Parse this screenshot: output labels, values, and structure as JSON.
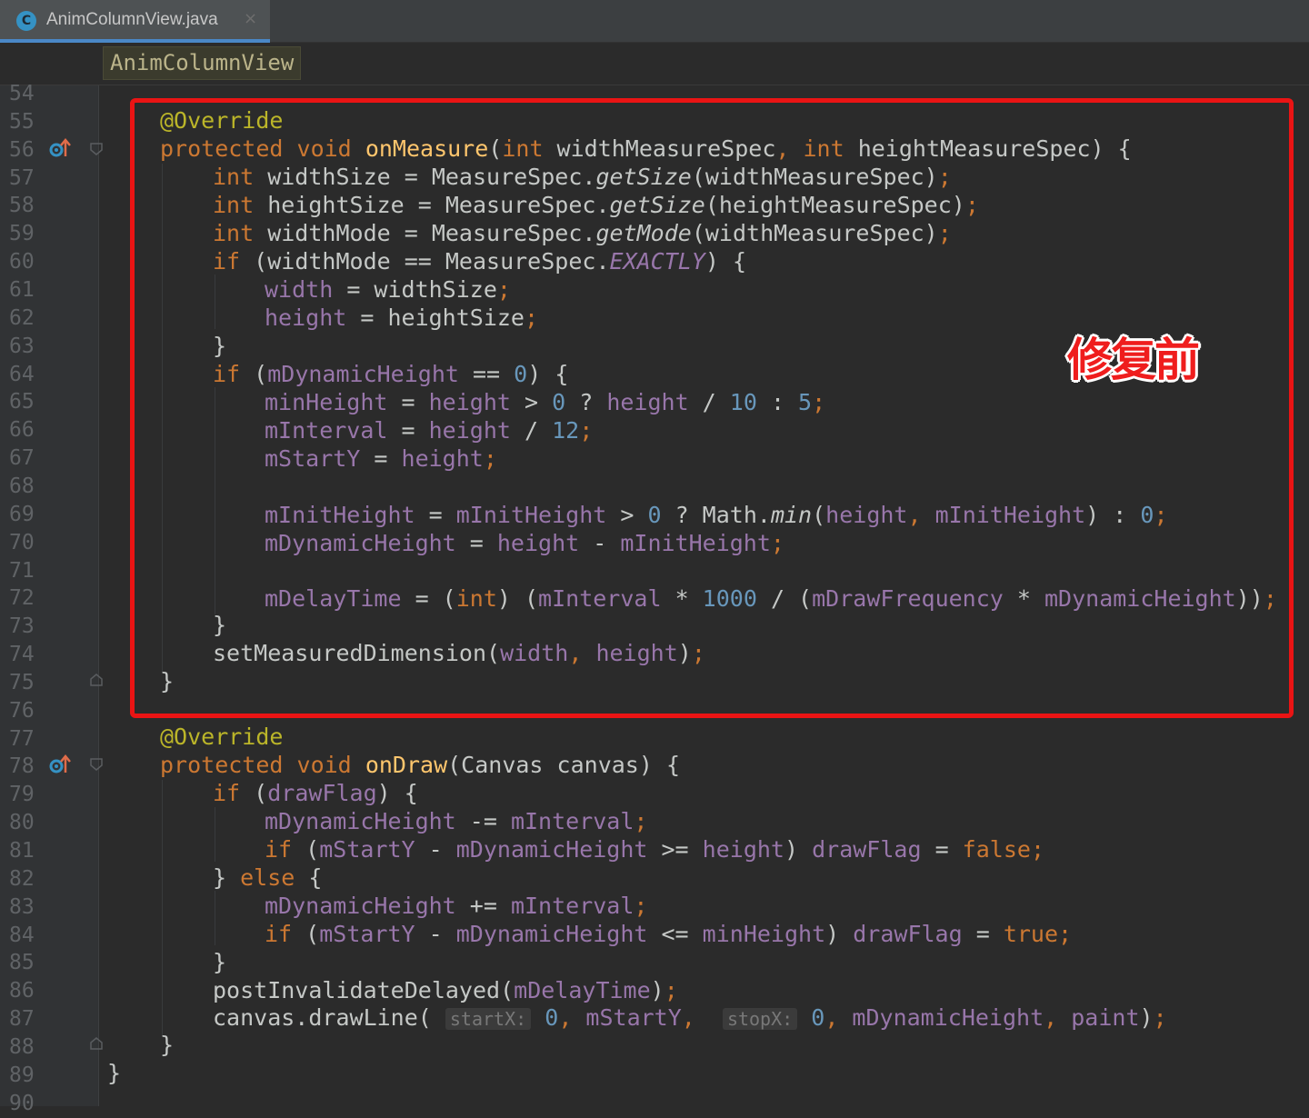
{
  "tab": {
    "icon_letter": "C",
    "filename": "AnimColumnView.java",
    "close_symbol": "×"
  },
  "breadcrumb": {
    "class_name": "AnimColumnView"
  },
  "line_numbers": [
    "54",
    "55",
    "56",
    "57",
    "58",
    "59",
    "60",
    "61",
    "62",
    "63",
    "64",
    "65",
    "66",
    "67",
    "68",
    "69",
    "70",
    "71",
    "72",
    "73",
    "74",
    "75",
    "76",
    "77",
    "78",
    "79",
    "80",
    "81",
    "82",
    "83",
    "84",
    "85",
    "86",
    "87",
    "88",
    "89",
    "90"
  ],
  "annotation": {
    "label": "修复前",
    "color": "#ea1414"
  },
  "colors": {
    "keyword": "#cc7832",
    "annotation": "#bbb529",
    "method": "#ffc66d",
    "field": "#9876aa",
    "number": "#6897bb",
    "text": "#c5c8c6"
  },
  "gutter_icons": [
    "override-method-icon",
    "override-method-icon"
  ],
  "code": {
    "l55": {
      "annotation": "@Override"
    },
    "l56": {
      "t1": "protected",
      "t2": "void",
      "t3": "onMeasure",
      "t4": "(",
      "t5": "int",
      "t6": " widthMeasureSpec",
      "t7": ", ",
      "t8": "int",
      "t9": " heightMeasureSpec) {"
    },
    "l57": {
      "t1": "int",
      "t2": " widthSize = MeasureSpec.",
      "t3": "getSize",
      "t4": "(widthMeasureSpec)",
      "t5": ";"
    },
    "l58": {
      "t1": "int",
      "t2": " heightSize = MeasureSpec.",
      "t3": "getSize",
      "t4": "(heightMeasureSpec)",
      "t5": ";"
    },
    "l59": {
      "t1": "int",
      "t2": " widthMode = MeasureSpec.",
      "t3": "getMode",
      "t4": "(widthMeasureSpec)",
      "t5": ";"
    },
    "l60": {
      "t1": "if",
      "t2": " (widthMode == MeasureSpec.",
      "t3": "EXACTLY",
      "t4": ") {"
    },
    "l61": {
      "t1": "width",
      "t2": " = widthSize",
      "t3": ";"
    },
    "l62": {
      "t1": "height",
      "t2": " = heightSize",
      "t3": ";"
    },
    "l63": {
      "t1": "}"
    },
    "l64": {
      "t1": "if",
      "t2": " (",
      "t3": "mDynamicHeight",
      "t4": " == ",
      "t5": "0",
      "t6": ") {"
    },
    "l65": {
      "t1": "minHeight",
      "t2": " = ",
      "t3": "height",
      "t4": " > ",
      "t5": "0",
      "t6": " ? ",
      "t7": "height",
      "t8": " / ",
      "t9": "10",
      "t10": " : ",
      "t11": "5",
      "t12": ";"
    },
    "l66": {
      "t1": "mInterval",
      "t2": " = ",
      "t3": "height",
      "t4": " / ",
      "t5": "12",
      "t6": ";"
    },
    "l67": {
      "t1": "mStartY",
      "t2": " = ",
      "t3": "height",
      "t4": ";"
    },
    "l69": {
      "t1": "mInitHeight",
      "t2": " = ",
      "t3": "mInitHeight",
      "t4": " > ",
      "t5": "0",
      "t6": " ? Math.",
      "t7": "min",
      "t8": "(",
      "t9": "height",
      "t10": ", ",
      "t11": "mInitHeight",
      "t12": ") : ",
      "t13": "0",
      "t14": ";"
    },
    "l70": {
      "t1": "mDynamicHeight",
      "t2": " = ",
      "t3": "height",
      "t4": " - ",
      "t5": "mInitHeight",
      "t6": ";"
    },
    "l72": {
      "t1": "mDelayTime",
      "t2": " = (",
      "t3": "int",
      "t4": ") (",
      "t5": "mInterval",
      "t6": " * ",
      "t7": "1000",
      "t8": " / (",
      "t9": "mDrawFrequency",
      "t10": " * ",
      "t11": "mDynamicHeight",
      "t12": "))",
      "t13": ";"
    },
    "l73": {
      "t1": "}"
    },
    "l74": {
      "t1": "setMeasuredDimension(",
      "t2": "width",
      "t3": ", ",
      "t4": "height",
      "t5": ")",
      "t6": ";"
    },
    "l75": {
      "t1": "}"
    },
    "l77": {
      "annotation": "@Override"
    },
    "l78": {
      "t1": "protected",
      "t2": "void",
      "t3": "onDraw",
      "t4": "(Canvas canvas) {"
    },
    "l79": {
      "t1": "if",
      "t2": " (",
      "t3": "drawFlag",
      "t4": ") {"
    },
    "l80": {
      "t1": "mDynamicHeight",
      "t2": " -= ",
      "t3": "mInterval",
      "t4": ";"
    },
    "l81": {
      "t1": "if",
      "t2": " (",
      "t3": "mStartY",
      "t4": " - ",
      "t5": "mDynamicHeight",
      "t6": " >= ",
      "t7": "height",
      "t8": ") ",
      "t9": "drawFlag",
      "t10": " = ",
      "t11": "false",
      "t12": ";"
    },
    "l82": {
      "t1": "} ",
      "t2": "else",
      "t3": " {"
    },
    "l83": {
      "t1": "mDynamicHeight",
      "t2": " += ",
      "t3": "mInterval",
      "t4": ";"
    },
    "l84": {
      "t1": "if",
      "t2": " (",
      "t3": "mStartY",
      "t4": " - ",
      "t5": "mDynamicHeight",
      "t6": " <= ",
      "t7": "minHeight",
      "t8": ") ",
      "t9": "drawFlag",
      "t10": " = ",
      "t11": "true",
      "t12": ";"
    },
    "l85": {
      "t1": "}"
    },
    "l86": {
      "t1": "postInvalidateDelayed(",
      "t2": "mDelayTime",
      "t3": ")",
      "t4": ";"
    },
    "l87": {
      "t1": "canvas.drawLine(",
      "h1": "startX:",
      "t2": "0",
      "t3": ", ",
      "t4": "mStartY",
      "t5": ",  ",
      "h2": "stopX:",
      "t6": "0",
      "t7": ", ",
      "t8": "mDynamicHeight",
      "t9": ", ",
      "t10": "paint",
      "t11": ")",
      "t12": ";"
    },
    "l88": {
      "t1": "}"
    },
    "l89": {
      "t1": "}"
    }
  }
}
